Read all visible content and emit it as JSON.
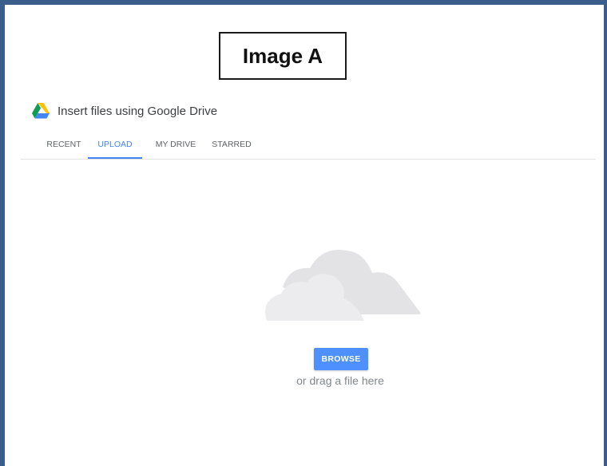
{
  "caption": "Image A",
  "dialog": {
    "title": "Insert files using Google Drive",
    "logo_icon": "google-drive-icon"
  },
  "tabs": [
    {
      "label": "RECENT",
      "active": false
    },
    {
      "label": "UPLOAD",
      "active": true
    },
    {
      "label": "MY DRIVE",
      "active": false
    },
    {
      "label": "STARRED",
      "active": false
    }
  ],
  "upload": {
    "illustration_icon": "cloud-icon",
    "browse_label": "BROWSE",
    "drag_hint": "or drag a file here"
  },
  "colors": {
    "frame_border": "#3a5d8c",
    "accent": "#4285f4",
    "button": "#4d90fe",
    "cloud": "#e6e6e8"
  }
}
